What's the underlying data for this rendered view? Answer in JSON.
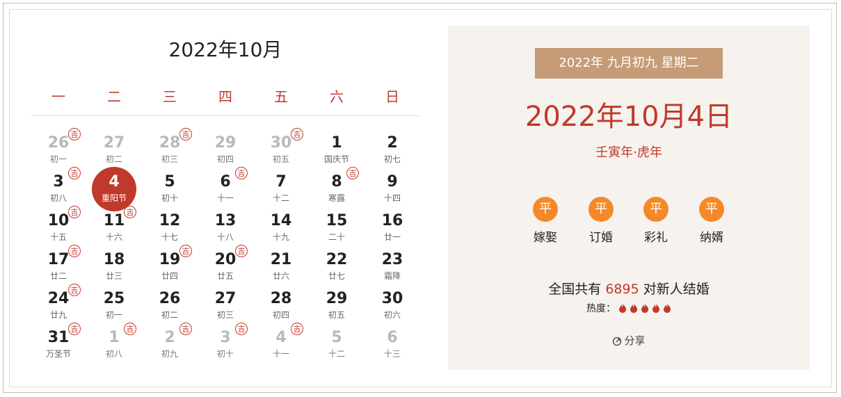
{
  "calendar": {
    "title": "2022年10月",
    "weekdays": [
      "一",
      "二",
      "三",
      "四",
      "五",
      "六",
      "日"
    ],
    "badge_text": "吉",
    "weeks": [
      [
        {
          "day": "26",
          "lunar": "初一",
          "other": true,
          "ji": true
        },
        {
          "day": "27",
          "lunar": "初二",
          "other": true,
          "ji": false
        },
        {
          "day": "28",
          "lunar": "初三",
          "other": true,
          "ji": true
        },
        {
          "day": "29",
          "lunar": "初四",
          "other": true,
          "ji": false
        },
        {
          "day": "30",
          "lunar": "初五",
          "other": true,
          "ji": true
        },
        {
          "day": "1",
          "lunar": "国庆节",
          "other": false,
          "ji": false
        },
        {
          "day": "2",
          "lunar": "初七",
          "other": false,
          "ji": false
        }
      ],
      [
        {
          "day": "3",
          "lunar": "初八",
          "other": false,
          "ji": true
        },
        {
          "day": "4",
          "lunar": "重阳节",
          "other": false,
          "ji": false,
          "today": true
        },
        {
          "day": "5",
          "lunar": "初十",
          "other": false,
          "ji": false
        },
        {
          "day": "6",
          "lunar": "十一",
          "other": false,
          "ji": true
        },
        {
          "day": "7",
          "lunar": "十二",
          "other": false,
          "ji": false
        },
        {
          "day": "8",
          "lunar": "寒露",
          "other": false,
          "ji": true
        },
        {
          "day": "9",
          "lunar": "十四",
          "other": false,
          "ji": false
        }
      ],
      [
        {
          "day": "10",
          "lunar": "十五",
          "other": false,
          "ji": true
        },
        {
          "day": "11",
          "lunar": "十六",
          "other": false,
          "ji": true
        },
        {
          "day": "12",
          "lunar": "十七",
          "other": false,
          "ji": false
        },
        {
          "day": "13",
          "lunar": "十八",
          "other": false,
          "ji": false
        },
        {
          "day": "14",
          "lunar": "十九",
          "other": false,
          "ji": false
        },
        {
          "day": "15",
          "lunar": "二十",
          "other": false,
          "ji": false
        },
        {
          "day": "16",
          "lunar": "廿一",
          "other": false,
          "ji": false
        }
      ],
      [
        {
          "day": "17",
          "lunar": "廿二",
          "other": false,
          "ji": true
        },
        {
          "day": "18",
          "lunar": "廿三",
          "other": false,
          "ji": false
        },
        {
          "day": "19",
          "lunar": "廿四",
          "other": false,
          "ji": true
        },
        {
          "day": "20",
          "lunar": "廿五",
          "other": false,
          "ji": true
        },
        {
          "day": "21",
          "lunar": "廿六",
          "other": false,
          "ji": false
        },
        {
          "day": "22",
          "lunar": "廿七",
          "other": false,
          "ji": false
        },
        {
          "day": "23",
          "lunar": "霜降",
          "other": false,
          "ji": false
        }
      ],
      [
        {
          "day": "24",
          "lunar": "廿九",
          "other": false,
          "ji": true
        },
        {
          "day": "25",
          "lunar": "初一",
          "other": false,
          "ji": false
        },
        {
          "day": "26",
          "lunar": "初二",
          "other": false,
          "ji": false
        },
        {
          "day": "27",
          "lunar": "初三",
          "other": false,
          "ji": false
        },
        {
          "day": "28",
          "lunar": "初四",
          "other": false,
          "ji": false
        },
        {
          "day": "29",
          "lunar": "初五",
          "other": false,
          "ji": false
        },
        {
          "day": "30",
          "lunar": "初六",
          "other": false,
          "ji": false
        }
      ],
      [
        {
          "day": "31",
          "lunar": "万圣节",
          "other": false,
          "ji": true
        },
        {
          "day": "1",
          "lunar": "初八",
          "other": true,
          "ji": true
        },
        {
          "day": "2",
          "lunar": "初九",
          "other": true,
          "ji": true
        },
        {
          "day": "3",
          "lunar": "初十",
          "other": true,
          "ji": true
        },
        {
          "day": "4",
          "lunar": "十一",
          "other": true,
          "ji": true
        },
        {
          "day": "5",
          "lunar": "十二",
          "other": true,
          "ji": false
        },
        {
          "day": "6",
          "lunar": "十三",
          "other": true,
          "ji": false
        }
      ]
    ]
  },
  "detail": {
    "lunar_bar": "2022年  九月初九  星期二",
    "big_date": "2022年10月4日",
    "ganzhi": "壬寅年·虎年",
    "fortunes": [
      {
        "level": "平",
        "label": "嫁娶"
      },
      {
        "level": "平",
        "label": "订婚"
      },
      {
        "level": "平",
        "label": "彩礼"
      },
      {
        "level": "平",
        "label": "纳婿"
      }
    ],
    "couples_prefix": "全国共有 ",
    "couples_count": "6895",
    "couples_suffix": " 对新人结婚",
    "heat_label": "热度：",
    "heat_level": 5,
    "share_label": "分享"
  },
  "colors": {
    "accent": "#c0392b",
    "fortune": "#f5892a",
    "lunar_bar": "#c59c77",
    "panel_bg": "#f6f2ed"
  }
}
